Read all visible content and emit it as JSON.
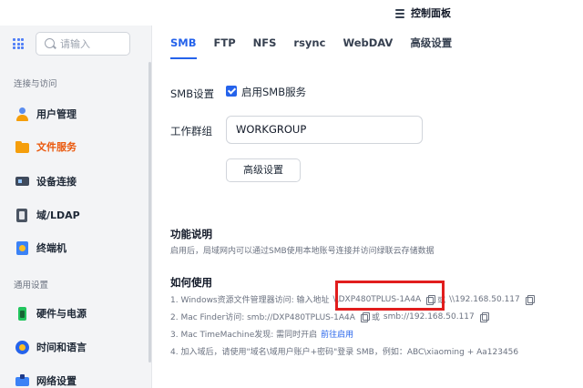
{
  "window": {
    "title": "控制面板",
    "title_icon": "sliders-icon"
  },
  "sidebar": {
    "search_placeholder": "请输入",
    "sections": [
      {
        "label": "连接与访问"
      },
      {
        "label": "通用设置"
      }
    ],
    "items": [
      {
        "label": "用户管理",
        "icon": "user-icon"
      },
      {
        "label": "文件服务",
        "icon": "folder-icon",
        "active": true
      },
      {
        "label": "设备连接",
        "icon": "device-icon"
      },
      {
        "label": "域/LDAP",
        "icon": "domain-icon"
      },
      {
        "label": "终端机",
        "icon": "terminal-icon"
      },
      {
        "label": "硬件与电源",
        "icon": "power-icon"
      },
      {
        "label": "时间和语言",
        "icon": "clock-icon"
      },
      {
        "label": "网络设置",
        "icon": "network-icon"
      }
    ]
  },
  "tabs": [
    {
      "label": "SMB",
      "active": true
    },
    {
      "label": "FTP"
    },
    {
      "label": "NFS"
    },
    {
      "label": "rsync"
    },
    {
      "label": "WebDAV"
    },
    {
      "label": "高级设置"
    }
  ],
  "smb": {
    "label": "SMB设置",
    "enable_label": "启用SMB服务",
    "enabled": true,
    "workgroup_label": "工作群组",
    "workgroup_value": "WORKGROUP",
    "advanced_button": "高级设置"
  },
  "info": {
    "title": "功能说明",
    "text": "启用后，局域网内可以通过SMB使用本地账号连接并访问绿联云存储数据"
  },
  "usage": {
    "title": "如何使用",
    "step1_prefix": "1. Windows资源文件管理器访问:  输入地址",
    "step1_addr1": "\\\\DXP480TPLUS-1A4A",
    "step1_or": "或",
    "step1_addr2": "\\\\192.168.50.117",
    "step2_prefix": "2. Mac Finder访问:  smb://DXP480TPLUS-1A4A",
    "step2_or": "或",
    "step2_addr2": "smb://192.168.50.117",
    "step3_prefix": "3. Mac TimeMachine发现:  需同时开启",
    "step3_link": "前往启用",
    "step4": "4. 加入域后，请使用\"域名\\域用户账户+密码\"登录 SMB，例如：ABC\\xiaoming + Aa123456"
  },
  "colors": {
    "accent": "#2563eb",
    "active_nav": "#ea580c",
    "highlight": "#e11d1d"
  }
}
